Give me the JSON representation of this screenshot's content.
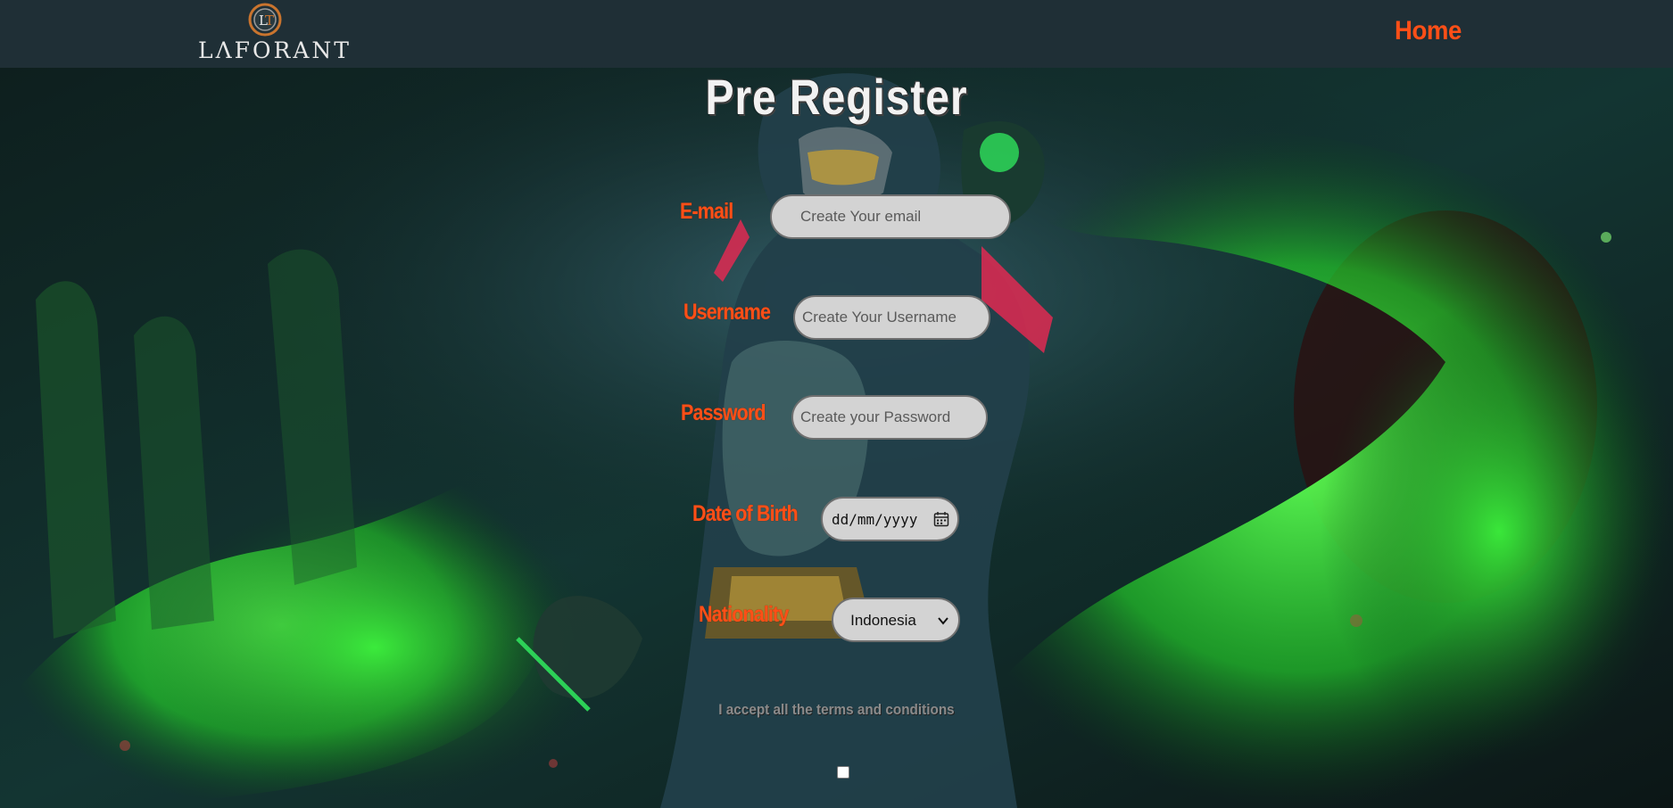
{
  "header": {
    "logo_text": "LΛFORANT",
    "nav_home": "Home"
  },
  "form": {
    "title": "Pre Register",
    "email": {
      "label": "E-mail",
      "placeholder": "Create Your email",
      "value": ""
    },
    "username": {
      "label": "Username",
      "placeholder": "Create Your Username",
      "value": ""
    },
    "password": {
      "label": "Password",
      "placeholder": "Create your Password",
      "value": ""
    },
    "dob": {
      "label": "Date of Birth",
      "placeholder": "dd/mm/yyyy"
    },
    "nationality": {
      "label": "Nationality",
      "selected": "Indonesia"
    },
    "terms": {
      "label": "I accept all the terms and conditions",
      "checked": false
    }
  },
  "colors": {
    "nav_bg": "#1f2f36",
    "accent": "#ff4f17",
    "field_bg": "#d3d3d3",
    "title": "#f2f2f2"
  },
  "icons": {
    "logo": "laforant-emblem-icon",
    "date": "calendar-icon",
    "select": "chevron-down-icon"
  }
}
